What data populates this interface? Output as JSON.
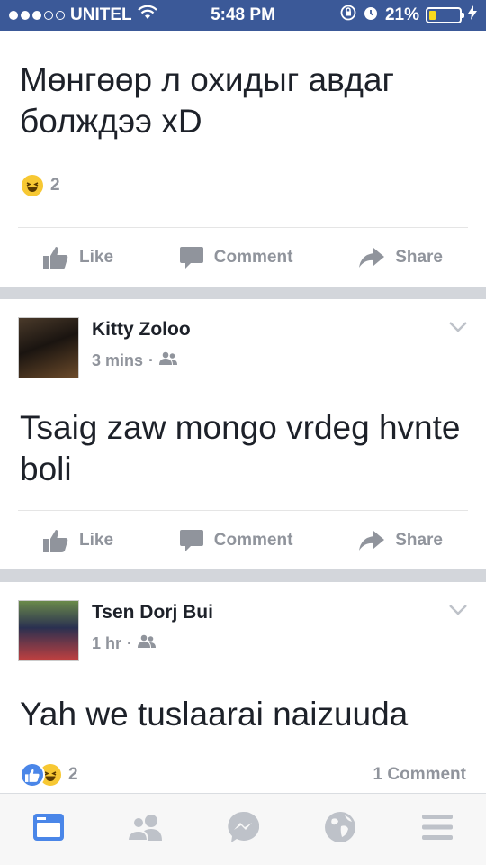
{
  "status_bar": {
    "carrier": "UNITEL",
    "time": "5:48 PM",
    "battery": "21%",
    "battery_level": 0.21,
    "accent_color": "#3b5998"
  },
  "posts": [
    {
      "text": "Мөнгөөр л охидыг авдаг болждээ xD",
      "reaction_types": [
        "haha"
      ],
      "reaction_count": "2",
      "actions": {
        "like": "Like",
        "comment": "Comment",
        "share": "Share"
      }
    },
    {
      "author": "Kitty Zoloo",
      "time": "3 mins",
      "separator": "·",
      "privacy_icon": "friends-icon",
      "text": "Tsaig zaw mongo vrdeg hvnte boli",
      "actions": {
        "like": "Like",
        "comment": "Comment",
        "share": "Share"
      }
    },
    {
      "author": "Tsen Dorj Bui",
      "time": "1 hr",
      "separator": "·",
      "privacy_icon": "friends-icon",
      "text": "Yah we tuslaarai naizuuda",
      "reaction_types": [
        "like",
        "haha"
      ],
      "reaction_count": "2",
      "comments_count": "1 Comment"
    }
  ],
  "tab_bar": {
    "tabs": [
      "news-feed-icon",
      "friends-icon",
      "messenger-icon",
      "globe-icon",
      "menu-icon"
    ],
    "active_color": "#4a86e8",
    "inactive_color": "#bec2c9"
  }
}
